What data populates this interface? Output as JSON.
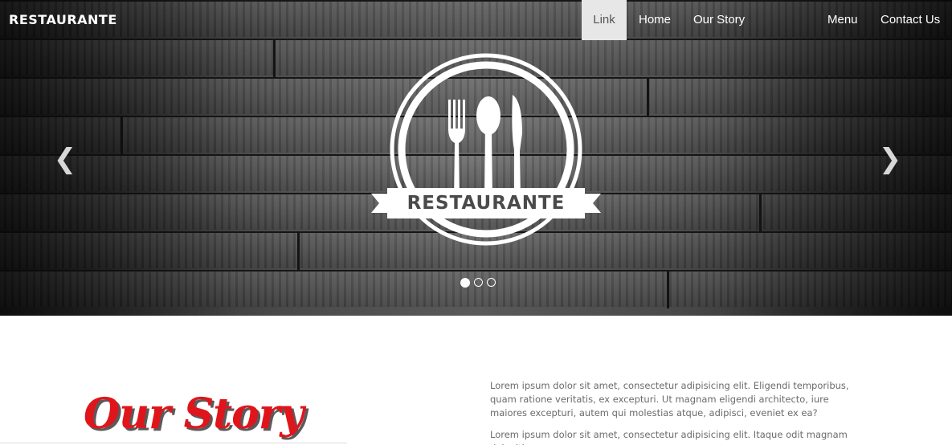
{
  "navbar": {
    "brand": "RESTAURANTE",
    "links": [
      {
        "label": "Link",
        "active": true
      },
      {
        "label": "Home"
      },
      {
        "label": "Our Story"
      },
      {
        "label": "Menu"
      },
      {
        "label": "Contact Us"
      }
    ],
    "active_bg": "#e7e7e7"
  },
  "hero": {
    "logo_text": "RESTAURANTE",
    "prev_icon": "chevron-left-icon",
    "next_icon": "chevron-right-icon",
    "prev_glyph": "❮",
    "next_glyph": "❯",
    "slides_total": 3,
    "active_slide": 1
  },
  "story": {
    "title": "Our Story",
    "title_color": "#e0151c",
    "paragraphs": [
      "Lorem ipsum dolor sit amet, consectetur adipisicing elit. Eligendi temporibus, quam ratione veritatis, ex excepturi. Ut magnam eligendi architecto, iure maiores excepturi, autem qui molestias atque, adipisci, eveniet ex ea?",
      "Lorem ipsum dolor sit amet, consectetur adipisicing elit. Itaque odit magnam deleniti,"
    ]
  }
}
